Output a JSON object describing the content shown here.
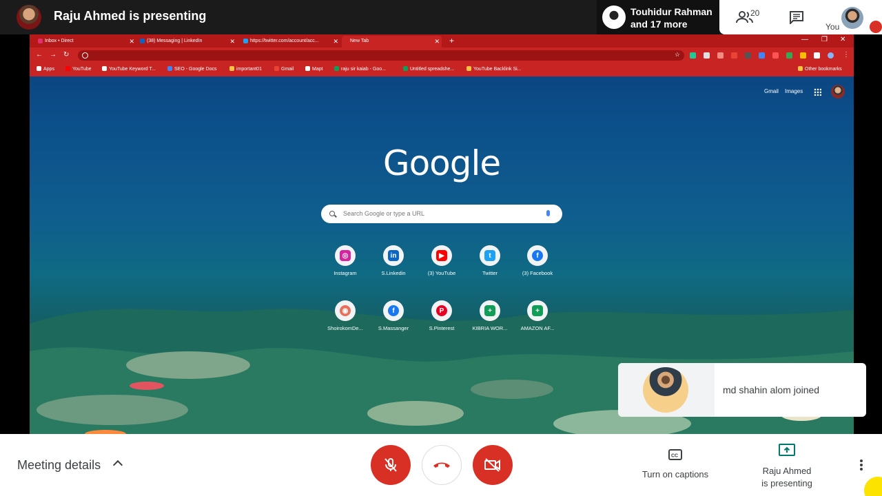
{
  "top_bar": {
    "presenter_title": "Raju Ahmed is presenting",
    "participant_name": "Touhidur Rahman",
    "participant_more": "and 17 more",
    "people_count": "20",
    "you_label": "You"
  },
  "browser": {
    "tabs": [
      {
        "label": "Inbox • Direct",
        "favicon_color": "#e1306c"
      },
      {
        "label": "(38) Messaging | LinkedIn",
        "favicon_color": "#0a66c2"
      },
      {
        "label": "https://twitter.com/account/acc...",
        "favicon_color": "#1da1f2"
      },
      {
        "label": "New Tab",
        "favicon_color": ""
      }
    ],
    "new_tab": "+",
    "bookmarks": [
      {
        "label": "Apps",
        "color": "#ffffff"
      },
      {
        "label": "YouTube",
        "color": "#ff0000"
      },
      {
        "label": "YouTube Keyword T...",
        "color": "#ffffff"
      },
      {
        "label": "SEO - Google Docs",
        "color": "#4285f4"
      },
      {
        "label": "important01",
        "color": "#f6c343"
      },
      {
        "label": "Gmail",
        "color": "#ea4335"
      },
      {
        "label": "Mapt",
        "color": "#ffffff"
      },
      {
        "label": "raju sir kaiab - Goo...",
        "color": "#0f9d58"
      },
      {
        "label": "Untitled spreadshe...",
        "color": "#0f9d58"
      },
      {
        "label": "YouTube Backlink Si...",
        "color": "#f6c343"
      },
      {
        "label": "Other bookmarks",
        "color": "#f6c343"
      }
    ]
  },
  "ntp": {
    "gmail_link": "Gmail",
    "images_link": "Images",
    "logo": "Google",
    "search_placeholder": "Search Google or type a URL",
    "shortcuts": [
      {
        "label": "Instagram",
        "glyph": "◎",
        "color": "#d6249f"
      },
      {
        "label": "S.Linkedin",
        "glyph": "in",
        "color": "#0a66c2"
      },
      {
        "label": "(3) YouTube",
        "glyph": "▶",
        "color": "#ff0000"
      },
      {
        "label": "Twitter",
        "glyph": "t",
        "color": "#1da1f2"
      },
      {
        "label": "(3) Facebook",
        "glyph": "f",
        "color": "#1877f2"
      },
      {
        "label": "ShoirokomDe...",
        "glyph": "◉",
        "color": "#e8705a"
      },
      {
        "label": "S.Massanger",
        "glyph": "f",
        "color": "#1877f2"
      },
      {
        "label": "S.Pinterest",
        "glyph": "P",
        "color": "#e60023"
      },
      {
        "label": "KIBRIA WOR...",
        "glyph": "+",
        "color": "#0f9d58"
      },
      {
        "label": "AMAZON AF...",
        "glyph": "+",
        "color": "#0f9d58"
      }
    ]
  },
  "toast": {
    "message": "md shahin alom joined"
  },
  "bottom_bar": {
    "meeting_details": "Meeting details",
    "captions_label": "Turn on captions",
    "presenting_label_1": "Raju Ahmed",
    "presenting_label_2": "is presenting"
  },
  "colors": {
    "control_red": "#d93025",
    "browser_red": "#c82424",
    "accent_teal": "#00796b"
  }
}
